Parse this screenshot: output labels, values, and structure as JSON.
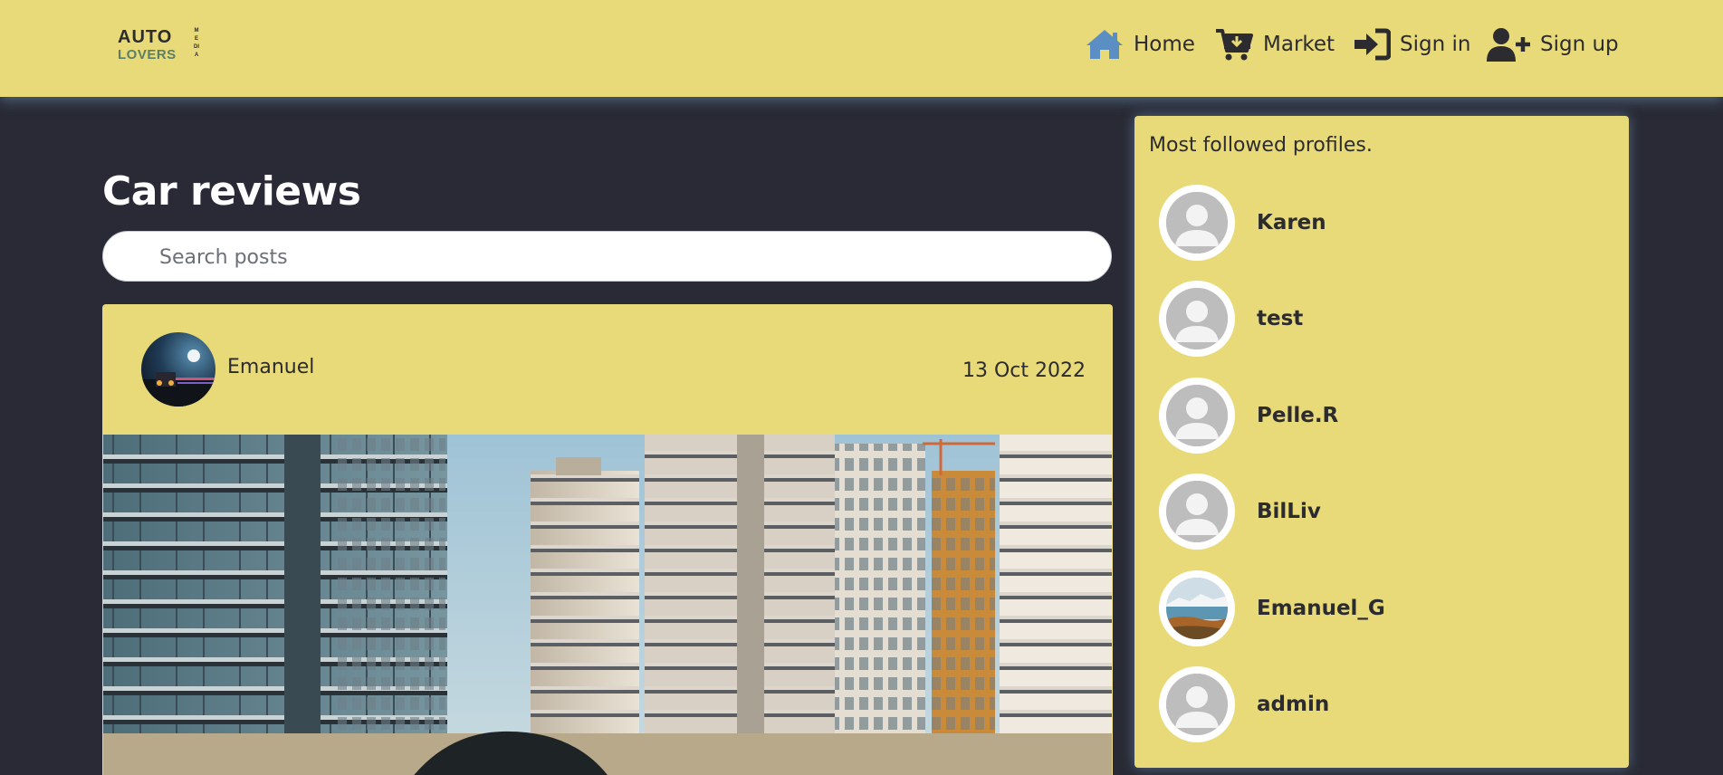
{
  "brand": {
    "line1": "AUTO",
    "line2": "LOVERS",
    "line3": "MEDIA"
  },
  "nav": {
    "home": "Home",
    "market": "Market",
    "signin": "Sign in",
    "signup": "Sign up",
    "home_icon_color": "#5b8fc4"
  },
  "main": {
    "title": "Car reviews",
    "search_placeholder": "Search posts"
  },
  "post": {
    "author": "Emanuel",
    "date": "13 Oct 2022"
  },
  "sidebar": {
    "title": "Most followed profiles.",
    "profiles": [
      {
        "name": "Karen",
        "avatar": "default"
      },
      {
        "name": "test",
        "avatar": "default"
      },
      {
        "name": "Pelle.R",
        "avatar": "default"
      },
      {
        "name": "BilLiv",
        "avatar": "default"
      },
      {
        "name": "Emanuel_G",
        "avatar": "landscape"
      },
      {
        "name": "admin",
        "avatar": "default"
      }
    ]
  },
  "colors": {
    "navbar": "#e8da78",
    "page_bg": "#292a35",
    "text": "#2b2b30",
    "accent_blue": "#5b8fc4"
  }
}
